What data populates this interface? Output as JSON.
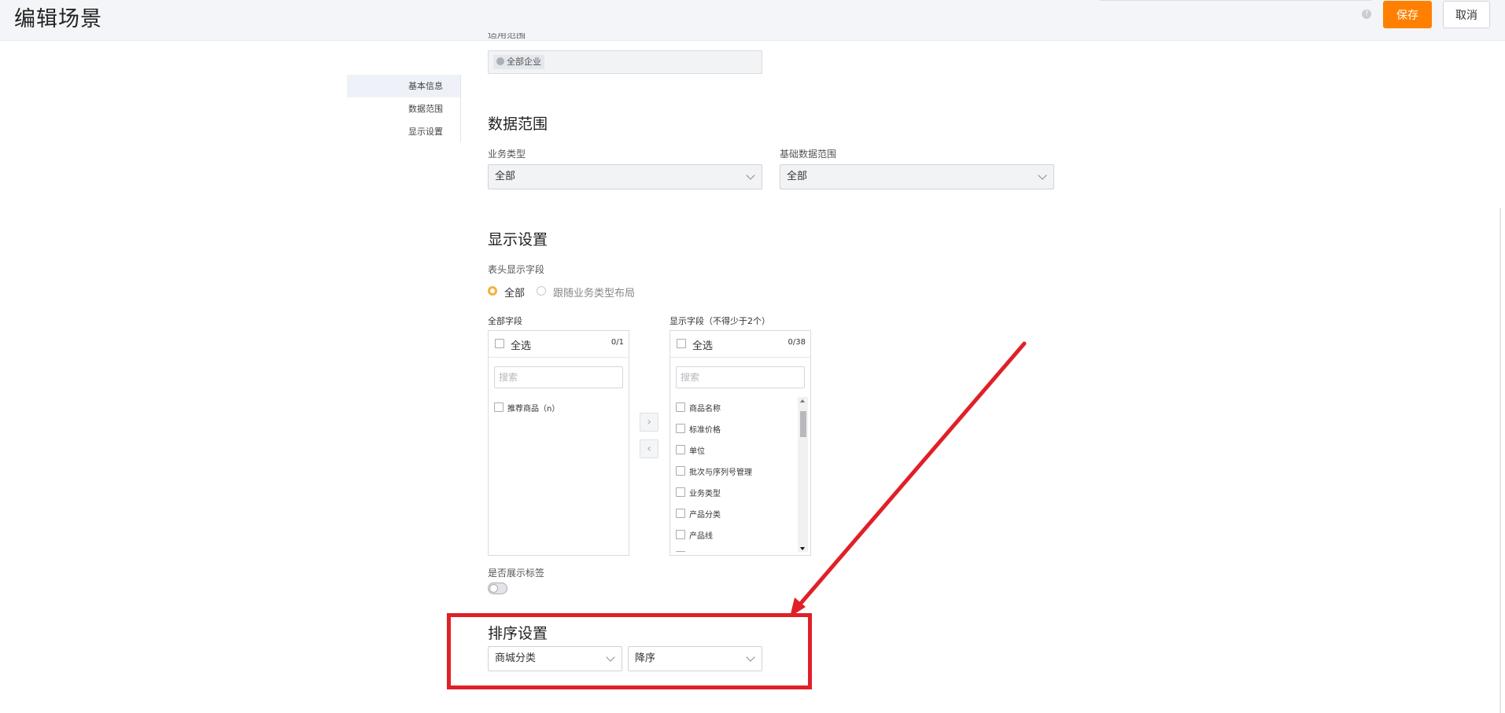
{
  "header": {
    "title": "编辑场景",
    "help_icon": "?",
    "save_label": "保存",
    "cancel_label": "取消"
  },
  "side_nav": {
    "items": [
      {
        "label": "基本信息",
        "active": true
      },
      {
        "label": "数据范围",
        "active": false
      },
      {
        "label": "显示设置",
        "active": false
      }
    ]
  },
  "basic_info": {
    "scope_label": "适用范围",
    "scope_tag": "全部企业"
  },
  "data_scope": {
    "title": "数据范围",
    "business_type": {
      "label": "业务类型",
      "value": "全部"
    },
    "base_data_scope": {
      "label": "基础数据范围",
      "value": "全部"
    }
  },
  "display_settings": {
    "title": "显示设置",
    "header_fields_label": "表头显示字段",
    "radio_all": "全部",
    "radio_follow": "跟随业务类型布局",
    "selected_radio": "全部",
    "all_fields": {
      "title": "全部字段",
      "select_all": "全选",
      "count": "0/1",
      "search_placeholder": "搜索",
      "items": [
        "推荐商品（n）"
      ]
    },
    "shown_fields": {
      "title": "显示字段（不得少于2个）",
      "select_all": "全选",
      "count": "0/38",
      "search_placeholder": "搜索",
      "items": [
        "商品名称",
        "标准价格",
        "单位",
        "批次与序列号管理",
        "业务类型",
        "产品分类",
        "产品线",
        "图片"
      ]
    },
    "move_right": "›",
    "move_left": "‹",
    "show_tags_label": "是否展示标签",
    "show_tags": false
  },
  "sort_settings": {
    "title": "排序设置",
    "field": "商城分类",
    "order": "降序"
  },
  "colors": {
    "accent": "#ff8000",
    "highlight": "#e02027",
    "radio_on": "#f4b23c"
  }
}
